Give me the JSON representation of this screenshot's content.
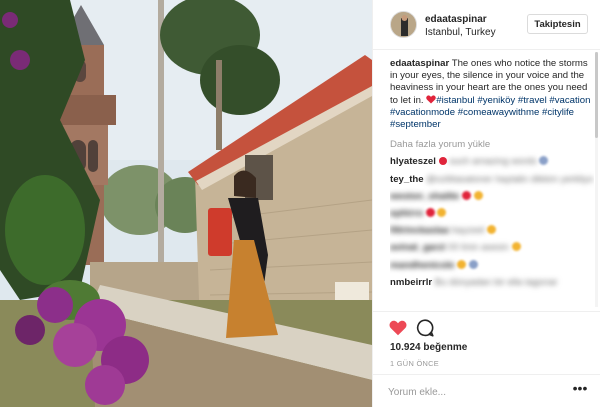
{
  "post": {
    "username": "edaataspinar",
    "location": "Istanbul, Turkey",
    "follow_label": "Takiptesin",
    "caption_user": "edaataspinar",
    "caption_text": "The ones who notice the storms in your eyes, the silence in your voice and the heaviness in your heart are the ones you need to let in.",
    "caption_emoji_icon": "red-heart-icon",
    "hashtags": [
      "#istanbul",
      "#yeniköy",
      "#travel",
      "#vacation",
      "#vacationmode",
      "#comeawaywithme",
      "#citylife",
      "#september"
    ],
    "load_more_label": "Daha fazla yorum yükle"
  },
  "comments": [
    {
      "user": "hlyateszel",
      "text": "such amazing words",
      "emoji": "red-heart-icon"
    },
    {
      "user": "tey_the",
      "text": "@ozliitasatoner haytalin dikkim yerkliyo"
    },
    {
      "user": "weston_shaitte",
      "text": "",
      "emoji": "red-heart-icon"
    },
    {
      "user": "ephirro",
      "text": "",
      "emoji": "red-heart-icon"
    },
    {
      "user": "filtrinckaslaa",
      "text": "hayzeel"
    },
    {
      "user": "avinat_garzi",
      "text": "00 linin asesin"
    },
    {
      "user": "mandhenicole",
      "text": ""
    },
    {
      "user": "nmbeirrlr",
      "text": "Bu dünyadan bir ella tagonar"
    }
  ],
  "actions": {
    "like_icon": "heart-icon",
    "comment_icon": "comment-bubble-icon"
  },
  "likes": {
    "count": "10.924",
    "label": "beğenme"
  },
  "time_ago": "1 GÜN ÖNCE",
  "add_comment": {
    "placeholder": "Yorum ekle...",
    "more_icon": "more-options-icon",
    "more_label": "•••"
  },
  "colors": {
    "hashtag": "#003569",
    "like_red": "#ed4956",
    "muted": "#999999",
    "border": "#efefef"
  }
}
